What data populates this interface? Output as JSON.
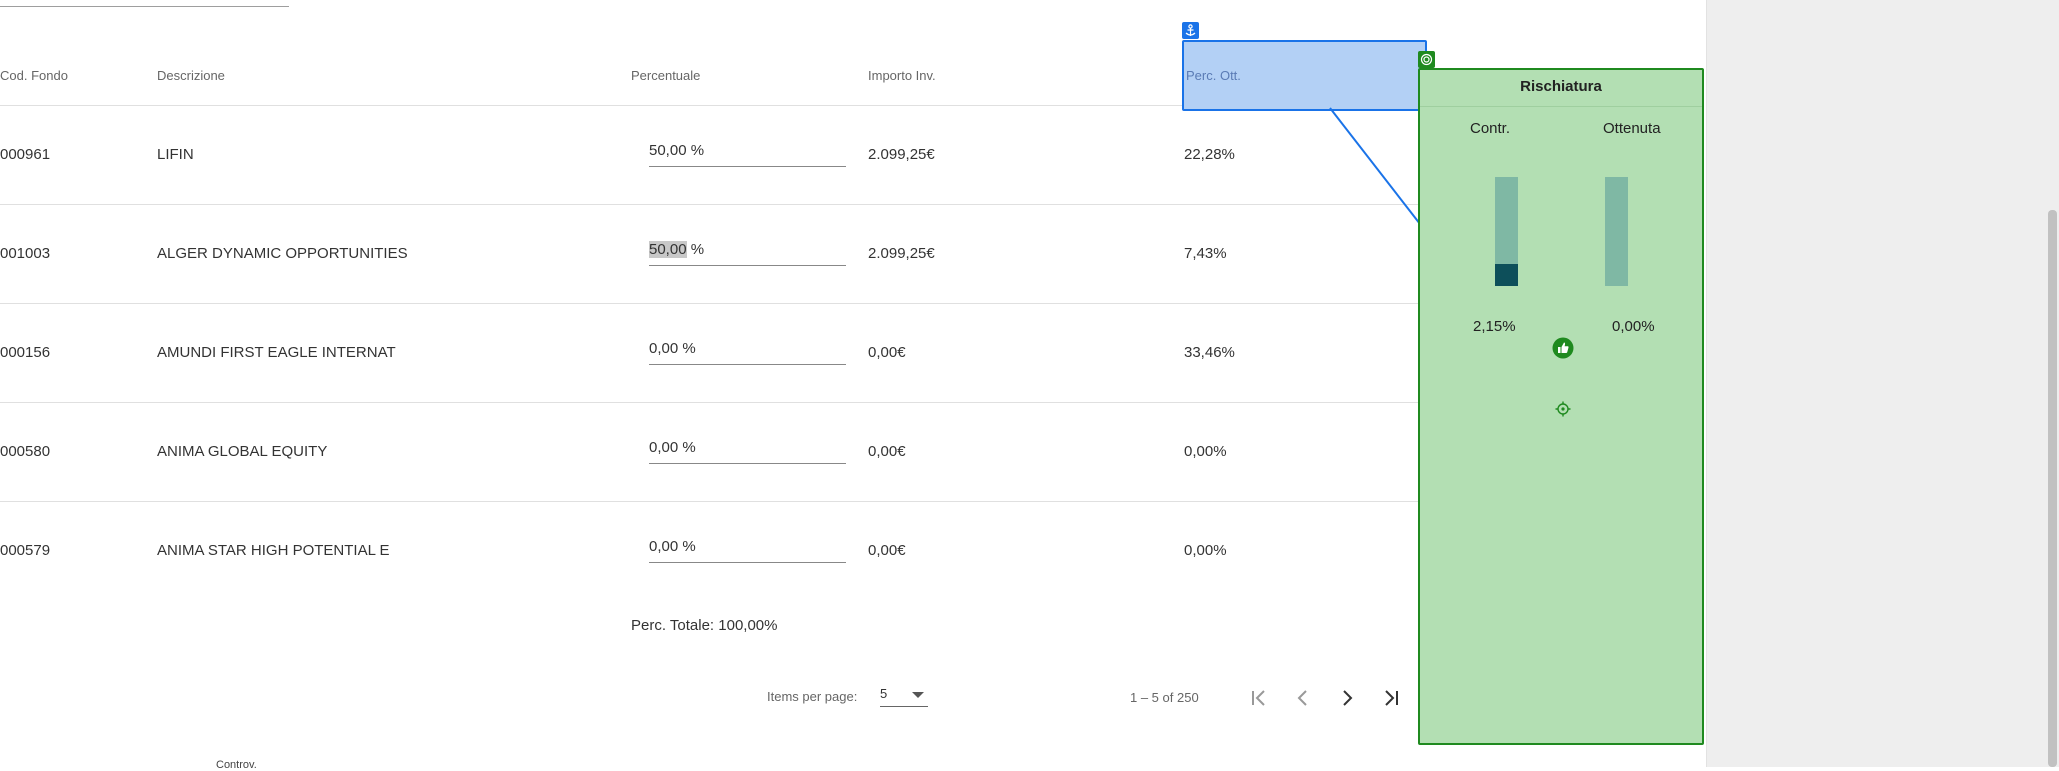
{
  "table": {
    "headers": {
      "cod_fondo": "Cod. Fondo",
      "descrizione": "Descrizione",
      "percentuale": "Percentuale",
      "importo_inv": "Importo Inv.",
      "perc_ott": "Perc. Ott."
    },
    "rows": [
      {
        "code": "000961",
        "description": "LIFIN",
        "percent_value": "50,00",
        "percent_unit": "%",
        "amount": "2.099,25€",
        "perc_ott": "22,28%"
      },
      {
        "code": "001003",
        "description": "ALGER DYNAMIC OPPORTUNITIES",
        "percent_value": "50,00",
        "percent_unit": "%",
        "amount": "2.099,25€",
        "perc_ott": "7,43%"
      },
      {
        "code": "000156",
        "description": "AMUNDI FIRST EAGLE INTERNAT",
        "percent_value": "0,00",
        "percent_unit": "%",
        "amount": "0,00€",
        "perc_ott": "33,46%"
      },
      {
        "code": "000580",
        "description": "ANIMA GLOBAL EQUITY",
        "percent_value": "0,00",
        "percent_unit": "%",
        "amount": "0,00€",
        "perc_ott": "0,00%"
      },
      {
        "code": "000579",
        "description": "ANIMA STAR HIGH POTENTIAL E",
        "percent_value": "0,00",
        "percent_unit": "%",
        "amount": "0,00€",
        "perc_ott": "0,00%"
      }
    ],
    "total": "Perc. Totale: 100,00%"
  },
  "paginator": {
    "items_per_page_label": "Items per page:",
    "page_size": "5",
    "range": "1 – 5 of 250",
    "buttons": [
      "first-page-icon",
      "prev-page-icon",
      "next-page-icon",
      "last-page-icon"
    ]
  },
  "footer": {
    "label": "Controv."
  },
  "overlay": {
    "anchor_label": "Perc. Ott.",
    "panel": {
      "title": "Rischiatura",
      "col_left": "Contr.",
      "col_right": "Ottenuta",
      "left_value": "2,15%",
      "right_value": "0,00%",
      "left_level": 0.2,
      "right_level": 0.0
    }
  },
  "colors": {
    "blue_border": "#1a73e8",
    "blue_fill": "#b3d0f5",
    "green_border": "#1f8a1f",
    "green_fill": "#b3dfb3",
    "bar_track": "#7fb8a4",
    "bar_fill": "#0d4f5a"
  }
}
